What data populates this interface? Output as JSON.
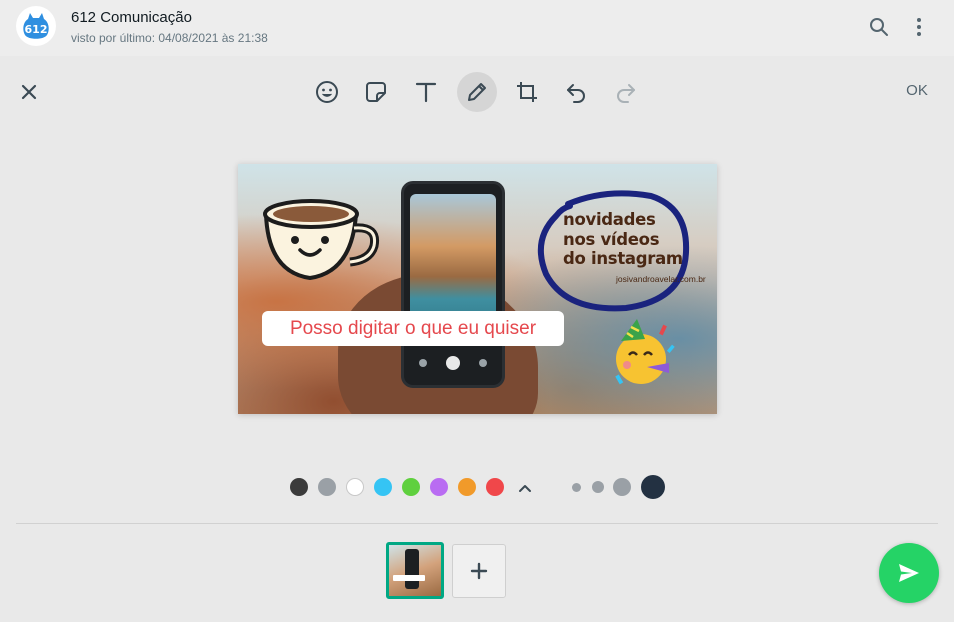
{
  "colors": {
    "accent": "#00a884",
    "send": "#25d366",
    "header_bg": "#ededed",
    "editor_bg": "#e9e9e9",
    "sticker_text": "#e5484d",
    "ink_circle": "#1a237e"
  },
  "header": {
    "avatar": {
      "label": "612",
      "icon": "avatar-logo"
    },
    "chat_name": "612 Comunicação",
    "last_seen": "visto por último: 04/08/2021 às 21:38",
    "icons": [
      "search-icon",
      "kebab-menu-icon"
    ]
  },
  "toolbar": {
    "close_icon": "close-icon",
    "tools": [
      {
        "name": "emoji",
        "icon": "emoji-icon",
        "active": false
      },
      {
        "name": "sticker",
        "icon": "sticker-icon",
        "active": false
      },
      {
        "name": "text",
        "icon": "text-icon",
        "active": false
      },
      {
        "name": "draw",
        "icon": "pencil-icon",
        "active": true
      },
      {
        "name": "crop",
        "icon": "crop-icon",
        "active": false
      },
      {
        "name": "undo",
        "icon": "undo-icon",
        "active": false
      },
      {
        "name": "redo",
        "icon": "redo-icon",
        "active": false
      }
    ],
    "ok_label": "OK"
  },
  "canvas": {
    "text_sticker": "Posso digitar o que eu quiser",
    "promo_line1": "novidades",
    "promo_line2": "nos vídeos",
    "promo_line3": "do instagram",
    "promo_url": "josivandroavelar.com.br",
    "emojis": [
      "coffee-mug-sticker",
      "party-face-emoji"
    ]
  },
  "palette": {
    "colors": [
      "#3b3b3b",
      "#9aa0a6",
      "#ffffff",
      "#35c4f4",
      "#5fd03e",
      "#b96cf2",
      "#f19a2a",
      "#f0474a"
    ],
    "expand_icon": "chevron-up-icon",
    "brush_sizes": [
      "small",
      "medium",
      "large",
      "xlarge"
    ],
    "selected_brush": "xlarge"
  },
  "bottom": {
    "thumbnail_count": 1,
    "add_icon": "plus-icon",
    "send_icon": "send-icon"
  }
}
